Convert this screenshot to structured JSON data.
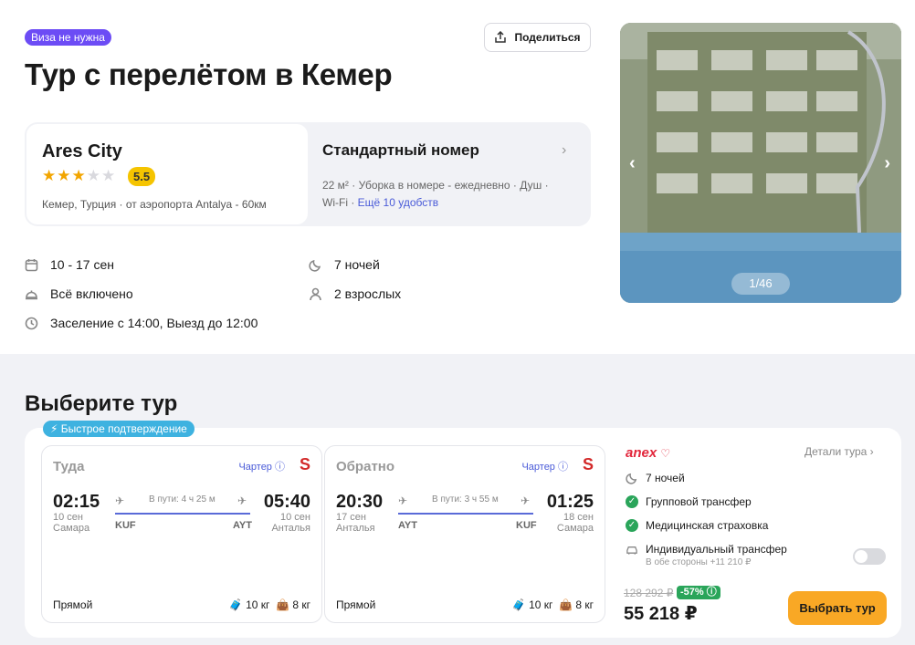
{
  "visa_badge": "Виза не нужна",
  "share_label": "Поделиться",
  "title": "Тур с перелётом в Кемер",
  "hotel": {
    "name": "Ares City",
    "stars": 3,
    "rating": "5.5",
    "location": "Кемер, Турция · от аэропорта Antalya - 60км"
  },
  "room": {
    "title": "Стандартный номер",
    "features": "22 м² · Уборка в номере - ежедневно · Душ ·",
    "features2": "Wi-Fi ·",
    "more_link": "Ещё 10 удобств"
  },
  "facts": {
    "dates": "10 - 17 сен",
    "meals": "Всё включено",
    "checkin": "Заселение с 14:00, Выезд до 12:00",
    "nights": "7 ночей",
    "guests": "2 взрослых"
  },
  "photo": {
    "counter": "1/46"
  },
  "choose_title": "Выберите тур",
  "fast_badge": "Быстрое подтверждение",
  "legs": [
    {
      "direction": "Туда",
      "charter": "Чартер",
      "dep_time": "02:15",
      "dep_date": "10 сен",
      "dep_city": "Самара",
      "arr_time": "05:40",
      "arr_date": "10 сен",
      "arr_city": "Анталья",
      "duration": "В пути: 4 ч 25 м",
      "from_iata": "KUF",
      "to_iata": "AYT",
      "type": "Прямой",
      "bag1": "10 кг",
      "bag2": "8 кг"
    },
    {
      "direction": "Обратно",
      "charter": "Чартер",
      "dep_time": "20:30",
      "dep_date": "17 сен",
      "dep_city": "Анталья",
      "arr_time": "01:25",
      "arr_date": "18 сен",
      "arr_city": "Самара",
      "duration": "В пути: 3 ч 55 м",
      "from_iata": "AYT",
      "to_iata": "KUF",
      "type": "Прямой",
      "bag1": "10 кг",
      "bag2": "8 кг"
    }
  ],
  "operator": {
    "brand": "anex",
    "details_link": "Детали тура",
    "nights": "7 ночей",
    "group_transfer": "Групповой трансфер",
    "insurance": "Медицинская страховка",
    "individual_transfer": "Индивидуальный трансфер",
    "individual_transfer_sub": "В обе стороны +11 210 ₽",
    "old_price": "128 292 ₽",
    "discount": "-57%",
    "price": "55 218 ₽",
    "choose_btn": "Выбрать тур"
  },
  "colors": {
    "accent": "#6c4cf5",
    "cta": "#f9a825",
    "ok": "#2aa55a",
    "brand": "#e2263b"
  }
}
